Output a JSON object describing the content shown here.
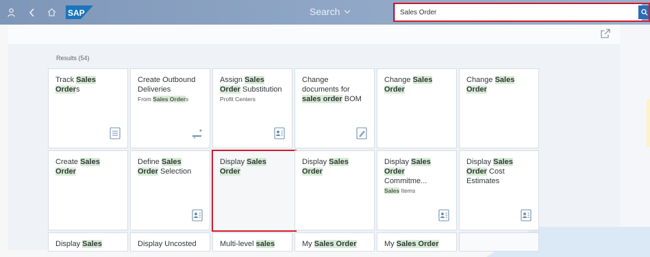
{
  "shell": {
    "search_label": "Search",
    "search_value": "Sales Order"
  },
  "results": {
    "label": "Results (54)"
  },
  "tiles": [
    {
      "pre": "Track ",
      "hl": "Sales Order",
      "post": "s",
      "pre2": "",
      "hl2": "",
      "post2": "",
      "sub": "",
      "subhl": "",
      "subpost": "",
      "icon": "list-doc-icon"
    },
    {
      "pre": "Create Outbound Deliveries",
      "hl": "",
      "post": "",
      "pre2": "",
      "hl2": "",
      "post2": "",
      "sub": "From ",
      "subhl": "Sales Order",
      "subpost": "s",
      "icon": "truck-add-icon"
    },
    {
      "pre": "Assign ",
      "hl": "Sales Order",
      "post": " Substitution",
      "pre2": "",
      "hl2": "",
      "post2": "",
      "sub": "Profit Centers",
      "subhl": "",
      "subpost": "",
      "icon": "person-doc-icon"
    },
    {
      "pre": "Change documents for ",
      "hl": "sales order",
      "post": " BOM",
      "pre2": "",
      "hl2": "",
      "post2": "",
      "sub": "",
      "subhl": "",
      "subpost": "",
      "icon": "edit-doc-icon"
    },
    {
      "pre": "Change ",
      "hl": "Sales Order",
      "post": "",
      "pre2": "",
      "hl2": "",
      "post2": "",
      "sub": "",
      "subhl": "",
      "subpost": "",
      "icon": ""
    },
    {
      "pre": "Change ",
      "hl": "Sales Order",
      "post": "",
      "pre2": "",
      "hl2": "",
      "post2": "",
      "sub": "",
      "subhl": "",
      "subpost": "",
      "icon": ""
    },
    {
      "pre": "Create ",
      "hl": "Sales Order",
      "post": "",
      "pre2": "",
      "hl2": "",
      "post2": "",
      "sub": "",
      "subhl": "",
      "subpost": "",
      "icon": ""
    },
    {
      "pre": "Define ",
      "hl": "Sales Order",
      "post": " Selection",
      "pre2": "",
      "hl2": "",
      "post2": "",
      "sub": "",
      "subhl": "",
      "subpost": "",
      "icon": "person-doc-icon"
    },
    {
      "pre": "Display ",
      "hl": "Sales Order",
      "post": "",
      "pre2": "",
      "hl2": "",
      "post2": "",
      "sub": "",
      "subhl": "",
      "subpost": "",
      "icon": ""
    },
    {
      "pre": "Display ",
      "hl": "Sales Order",
      "post": "",
      "pre2": "",
      "hl2": "",
      "post2": "",
      "sub": "",
      "subhl": "",
      "subpost": "",
      "icon": ""
    },
    {
      "pre": "Display ",
      "hl": "Sales Order",
      "post": " Commitme...",
      "pre2": "",
      "hl2": "",
      "post2": "",
      "sub": "",
      "subhl": "Sales",
      "subpost": " Items",
      "icon": "person-doc-icon"
    },
    {
      "pre": "Display ",
      "hl": "Sales Order",
      "post": " Cost Estimates",
      "pre2": "",
      "hl2": "",
      "post2": "",
      "sub": "",
      "subhl": "",
      "subpost": "",
      "icon": "person-doc-icon"
    },
    {
      "pre": "Display ",
      "hl": "Sales",
      "post": "",
      "pre2": "",
      "hl2": "",
      "post2": "",
      "sub": "",
      "subhl": "",
      "subpost": "",
      "icon": ""
    },
    {
      "pre": "Display Uncosted",
      "hl": "",
      "post": "",
      "pre2": "",
      "hl2": "",
      "post2": "",
      "sub": "",
      "subhl": "",
      "subpost": "",
      "icon": ""
    },
    {
      "pre": "Multi-level ",
      "hl": "sales",
      "post": "",
      "pre2": "",
      "hl2": "",
      "post2": "",
      "sub": "",
      "subhl": "",
      "subpost": "",
      "icon": ""
    },
    {
      "pre": "My ",
      "hl": "Sales Order",
      "post": "",
      "pre2": "",
      "hl2": "",
      "post2": "",
      "sub": "",
      "subhl": "",
      "subpost": "",
      "icon": ""
    },
    {
      "pre": "My ",
      "hl": "Sales Order",
      "post": "",
      "pre2": "",
      "hl2": "",
      "post2": "",
      "sub": "",
      "subhl": "",
      "subpost": "",
      "icon": ""
    },
    {
      "pre": "",
      "hl": "",
      "post": "",
      "pre2": "",
      "hl2": "",
      "post2": "",
      "sub": "",
      "subhl": "",
      "subpost": "",
      "icon": ""
    }
  ],
  "icons": {
    "user": "user-icon",
    "back": "back-icon",
    "home": "home-icon",
    "search": "search-icon",
    "share": "share-icon"
  },
  "colors": {
    "accent": "#2a6bb8",
    "highlight": "#d7ecd5",
    "selection": "#d4192a"
  }
}
